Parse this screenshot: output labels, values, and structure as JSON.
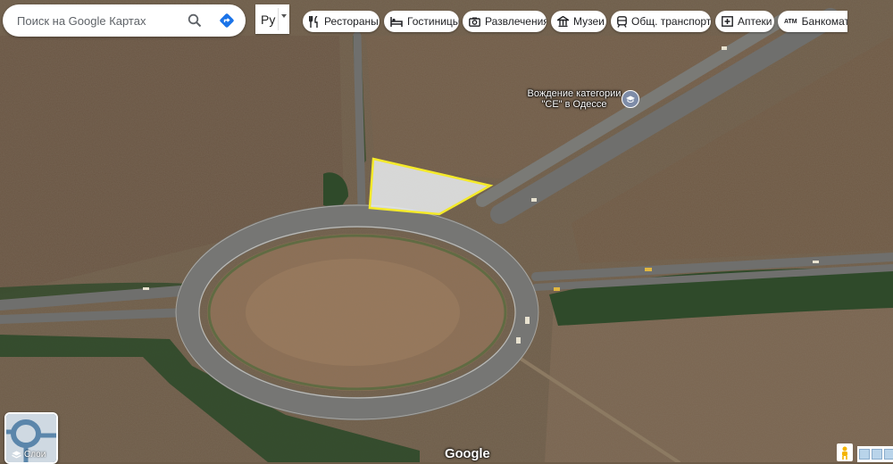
{
  "map": {
    "view": "satellite",
    "feature": "roundabout",
    "highlight_color": "#f4ea2a"
  },
  "search": {
    "placeholder": "Поиск на Google Картах",
    "icons": [
      "search-icon",
      "directions-icon"
    ]
  },
  "language": {
    "code": "Ру"
  },
  "categories": [
    {
      "label": "Рестораны",
      "icon": "fork-knife-icon"
    },
    {
      "label": "Гостиницы",
      "icon": "bed-icon"
    },
    {
      "label": "Развлечения",
      "icon": "camera-icon"
    },
    {
      "label": "Музеи",
      "icon": "museum-icon"
    },
    {
      "label": "Общ. транспорт",
      "icon": "train-icon"
    },
    {
      "label": "Аптеки",
      "icon": "pharmacy-icon"
    },
    {
      "label": "Банкоматы",
      "icon": "atm-icon"
    }
  ],
  "poi": {
    "label": "Вождение категории \"CE\" в Одессе",
    "icon": "school-icon"
  },
  "layers": {
    "label": "Слои"
  },
  "branding": {
    "logo": "Google"
  }
}
